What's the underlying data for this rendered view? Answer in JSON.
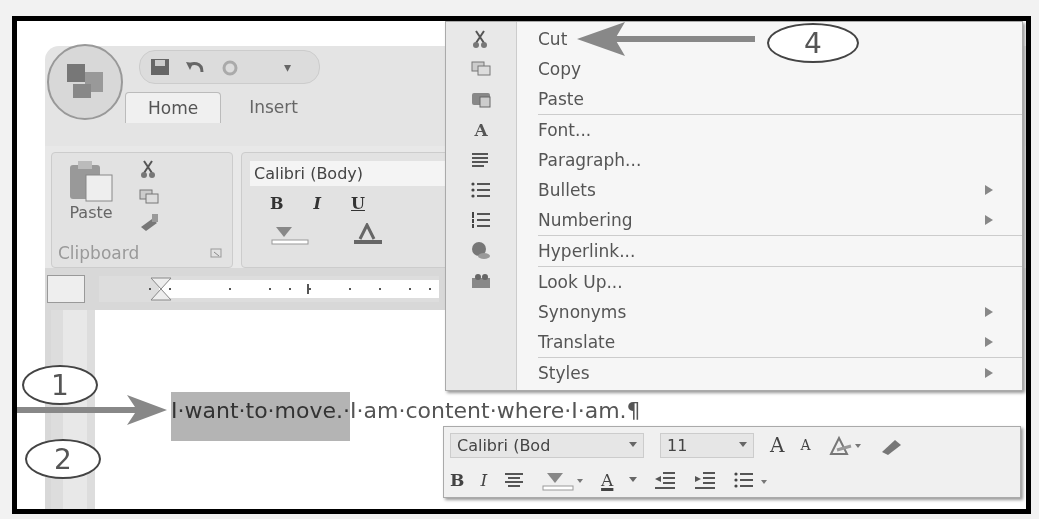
{
  "quick_access_toolbar": {
    "more_caret": "▾"
  },
  "tabs": [
    {
      "label": "Home",
      "selected": true
    },
    {
      "label": "Insert",
      "selected": false
    }
  ],
  "ribbon": {
    "paste_label": "Paste",
    "clipboard_group": "Clipboard",
    "font_name": "Calibri (Body)",
    "format_buttons": [
      "B",
      "I",
      "U"
    ]
  },
  "document": {
    "selected_text": "I·want·to·move.·",
    "text": "I·am·content·where·I·am.¶"
  },
  "context_menu": {
    "groups": [
      [
        {
          "label": "Cut",
          "kind": "icon",
          "submenu": false
        },
        {
          "label": "Copy",
          "kind": "icon",
          "submenu": false
        },
        {
          "label": "Paste",
          "kind": "icon",
          "submenu": false
        }
      ],
      [
        {
          "label": "Font...",
          "kind": "letter",
          "icon_text": "A",
          "submenu": false
        },
        {
          "label": "Paragraph...",
          "kind": "icon",
          "submenu": false
        },
        {
          "label": "Bullets",
          "kind": "icon",
          "submenu": true
        },
        {
          "label": "Numbering",
          "kind": "icon",
          "submenu": true
        }
      ],
      [
        {
          "label": "Hyperlink...",
          "kind": "icon",
          "submenu": false
        }
      ],
      [
        {
          "label": "Look Up...",
          "kind": "icon",
          "submenu": false
        },
        {
          "label": "Synonyms",
          "kind": "plain",
          "submenu": true
        },
        {
          "label": "Translate",
          "kind": "plain",
          "submenu": true
        }
      ],
      [
        {
          "label": "Styles",
          "kind": "plain",
          "submenu": true
        }
      ]
    ]
  },
  "mini_toolbar": {
    "font_field": "Calibri (Bod",
    "size_field": "11",
    "grow_font": "A",
    "shrink_font": "A",
    "bold": "B",
    "italic": "I",
    "font_color": "A"
  },
  "callouts": [
    {
      "label": "1"
    },
    {
      "label": "2"
    },
    {
      "label": "4"
    }
  ]
}
